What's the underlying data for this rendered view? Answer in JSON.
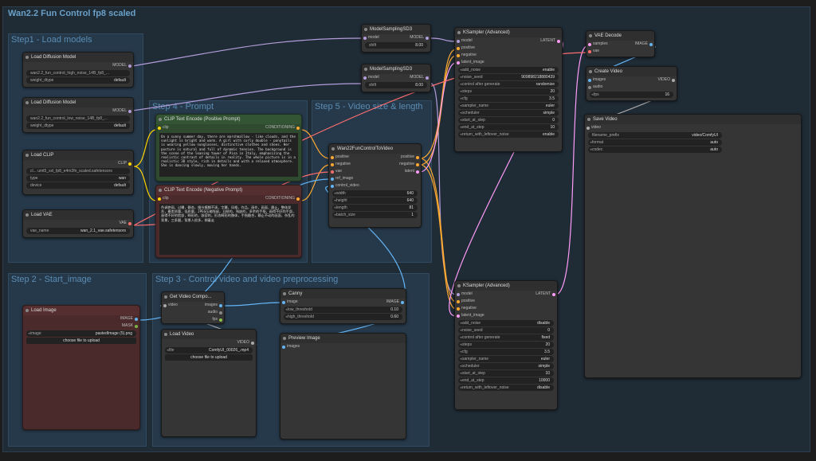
{
  "workflow_title": "Wan2.2 Fun Control fp8 scaled",
  "groups": {
    "g1": "Step1 - Load models",
    "g2": "Step 2 - Start_image",
    "g3": "Step 3 - Control video and video preprocessing",
    "g4": "Step 4 - Prompt",
    "g5": "Step 5 - Video size & length"
  },
  "load_diff_1": {
    "title": "Load Diffusion Model",
    "out": "MODEL",
    "unet_name": "wan2.2_fun_control_high_noise_14B_fp8_...",
    "weight_dtype_label": "weight_dtype",
    "weight_dtype": "default"
  },
  "load_diff_2": {
    "title": "Load Diffusion Model",
    "out": "MODEL",
    "unet_name": "wan2.2_fun_control_low_noise_14B_fp8_...",
    "weight_dtype_label": "weight_dtype",
    "weight_dtype": "default"
  },
  "load_clip": {
    "title": "Load CLIP",
    "out": "CLIP",
    "clip_name_label": "cl...",
    "clip_name": "umt5_xxl_fp8_e4m3fn_scaled.safetensors",
    "type_label": "type",
    "type": "wan",
    "device_label": "device",
    "device": "default"
  },
  "load_vae": {
    "title": "Load VAE",
    "out": "VAE",
    "vae_name_label": "vae_name",
    "vae_name": "wan_2.1_vae.safetensors"
  },
  "pos_prompt": {
    "title": "CLIP Text Encode (Positive Prompt)",
    "in": "clip",
    "out": "CONDITIONING",
    "text": "On a sunny summer day, there are marshmallow - like clouds, and the sunlight is bright and warm. A girl with curly double - ponytails is wearing yellow sunglasses, distinctive clothes and shoes. Her posture is natural and full of dynamic tension. The background is the scene of the leaning tower of Pisa in Italy, emphasizing the realistic contrast of details in reality. The whole picture is in a realistic 3D style, rich in details and with a relaxed atmosphere. She is dancing slowly, moving her hands."
  },
  "neg_prompt": {
    "title": "CLIP Text Encode (Negative Prompt)",
    "in": "clip",
    "out": "CONDITIONING",
    "text": "色调艳丽，过曝，静态，细节模糊不清，字幕，风格，作品，画作，画面，静止，整体发灰，最差质量，低质量，JPEG压缩残留，丑陋的，残缺的，多余的手指，画得不好的手部，画得不好的脸部，畸形的，毁容的，形态畸形的肢体，手指融合，静止不动的画面，杂乱的背景，三条腿，背景人很多，倒着走"
  },
  "ms1": {
    "title": "ModelSamplingSD3",
    "in": "model",
    "out": "MODEL",
    "shift_label": "shift",
    "shift": "8.00"
  },
  "ms2": {
    "title": "ModelSamplingSD3",
    "in": "model",
    "out": "MODEL",
    "shift_label": "shift",
    "shift": "8.00"
  },
  "wanfun": {
    "title": "Wan22FunControlToVideo",
    "ins": [
      "positive",
      "negative",
      "vae",
      "ref_image",
      "control_video"
    ],
    "outs": [
      "positive",
      "negative",
      "latent"
    ],
    "w": [
      {
        "k": "width",
        "v": "640"
      },
      {
        "k": "height",
        "v": "640"
      },
      {
        "k": "length",
        "v": "81"
      },
      {
        "k": "batch_size",
        "v": "1"
      }
    ]
  },
  "ks1": {
    "title": "KSampler (Advanced)",
    "ins": [
      "model",
      "positive",
      "negative",
      "latent_image"
    ],
    "out": "LATENT",
    "w": [
      {
        "k": "add_noise",
        "v": "enable"
      },
      {
        "k": "noise_seed",
        "v": "909898218880439"
      },
      {
        "k": "control after generate",
        "v": "randomize"
      },
      {
        "k": "steps",
        "v": "20"
      },
      {
        "k": "cfg",
        "v": "3.5"
      },
      {
        "k": "sampler_name",
        "v": "euler"
      },
      {
        "k": "scheduler",
        "v": "simple"
      },
      {
        "k": "start_at_step",
        "v": "0"
      },
      {
        "k": "end_at_step",
        "v": "10"
      },
      {
        "k": "return_with_leftover_noise",
        "v": "enable"
      }
    ]
  },
  "ks2": {
    "title": "KSampler (Advanced)",
    "ins": [
      "model",
      "positive",
      "negative",
      "latent_image"
    ],
    "out": "LATENT",
    "w": [
      {
        "k": "add_noise",
        "v": "disable"
      },
      {
        "k": "noise_seed",
        "v": "0"
      },
      {
        "k": "control after generate",
        "v": "fixed"
      },
      {
        "k": "steps",
        "v": "20"
      },
      {
        "k": "cfg",
        "v": "3.5"
      },
      {
        "k": "sampler_name",
        "v": "euler"
      },
      {
        "k": "scheduler",
        "v": "simple"
      },
      {
        "k": "start_at_step",
        "v": "10"
      },
      {
        "k": "end_at_step",
        "v": "10000"
      },
      {
        "k": "return_with_leftover_noise",
        "v": "disable"
      }
    ]
  },
  "vae_decode": {
    "title": "VAE Decode",
    "ins": [
      "samples",
      "vae"
    ],
    "out": "IMAGE"
  },
  "create_video": {
    "title": "Create Video",
    "ins": [
      "images",
      "audio"
    ],
    "out": "VIDEO",
    "fps_label": "fps",
    "fps": "16"
  },
  "save_video": {
    "title": "Save Video",
    "in": "video",
    "w": [
      {
        "k": "filename_prefix",
        "v": "video/ComfyUI"
      },
      {
        "k": "format",
        "v": "auto"
      },
      {
        "k": "codec",
        "v": "auto"
      }
    ]
  },
  "load_image": {
    "title": "Load Image",
    "outs": [
      "IMAGE",
      "MASK"
    ],
    "image_label": "image",
    "image": "pastedImage (5).png",
    "btn": "choose file to upload"
  },
  "get_video": {
    "title": "Get Video Compo...",
    "in": "video",
    "outs": [
      "images",
      "audio",
      "fps"
    ]
  },
  "load_video": {
    "title": "Load Video",
    "out": "VIDEO",
    "file_label": "file",
    "file": "ComfyUI_00026_.mp4",
    "btn": "choose file to upload"
  },
  "canny": {
    "title": "Canny",
    "in": "image",
    "out": "IMAGE",
    "w": [
      {
        "k": "low_threshold",
        "v": "0.10"
      },
      {
        "k": "high_threshold",
        "v": "0.60"
      }
    ]
  },
  "preview": {
    "title": "Preview Image",
    "in": "images"
  },
  "colors": {
    "model": "#b39ddb",
    "clip": "#ffd500",
    "vae": "#ff6e6e",
    "conditioning": "#ffa931",
    "latent": "#ff9cf9",
    "image": "#64b5f6",
    "video": "#aaaaaa"
  }
}
